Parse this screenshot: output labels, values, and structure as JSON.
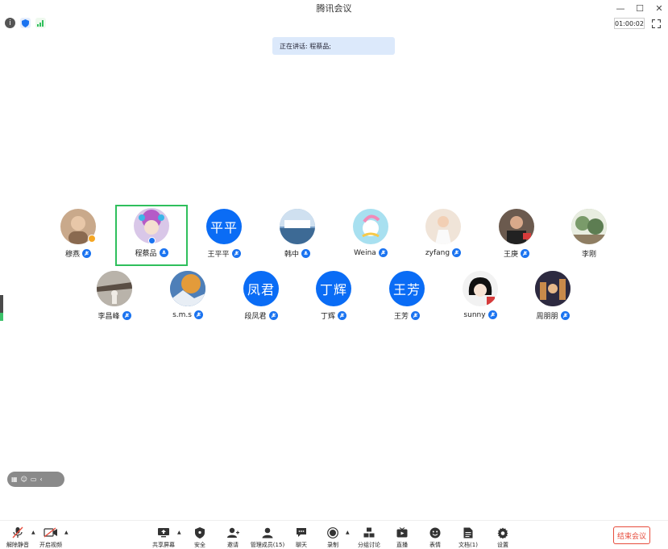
{
  "window": {
    "title": "腾讯会议",
    "controls": [
      "—",
      "☐",
      "✕"
    ]
  },
  "status": {
    "timer": "01:00:02"
  },
  "speaking": {
    "text": "正在讲话: 程蔡品;"
  },
  "participants": [
    {
      "name": "穆燕",
      "avatar_type": "photo",
      "color": "#c9a98b"
    },
    {
      "name": "程蔡品",
      "avatar_type": "photo",
      "color": "#d9c7e8"
    },
    {
      "name": "王平平",
      "avatar_type": "text",
      "avatar_text": "平平"
    },
    {
      "name": "韩中",
      "avatar_type": "photo",
      "color": "#7aa0c8"
    },
    {
      "name": "Weina",
      "avatar_type": "photo",
      "color": "#a8e0f0"
    },
    {
      "name": "zyfang",
      "avatar_type": "photo",
      "color": "#f0e4d8"
    },
    {
      "name": "王庚",
      "avatar_type": "photo",
      "color": "#6b5a4e"
    },
    {
      "name": "李刚",
      "avatar_type": "photo",
      "color": "#9bb08a"
    },
    {
      "name": "李昌峰",
      "avatar_type": "photo",
      "color": "#8a8580"
    },
    {
      "name": "s.m.s",
      "avatar_type": "photo",
      "color": "#4e7fb8"
    },
    {
      "name": "段凤君",
      "avatar_type": "text",
      "avatar_text": "凤君"
    },
    {
      "name": "丁辉",
      "avatar_type": "text",
      "avatar_text": "丁辉"
    },
    {
      "name": "王芳",
      "avatar_type": "text",
      "avatar_text": "王芳"
    },
    {
      "name": "sunny",
      "avatar_type": "photo",
      "color": "#f2f2f2"
    },
    {
      "name": "周朋朋",
      "avatar_type": "photo",
      "color": "#3a3040"
    }
  ],
  "toolbar": {
    "unmute": "解除静音",
    "start_video": "开启视频",
    "share_screen": "共享屏幕",
    "security": "安全",
    "invite": "邀请",
    "manage_members": "管理成员(15)",
    "chat": "聊天",
    "record": "录制",
    "breakout": "分组讨论",
    "live": "直播",
    "reactions": "表情",
    "docs": "文档(1)",
    "settings": "设置",
    "end_meeting": "结束会议"
  },
  "colors": {
    "accent": "#0a6cf5",
    "active_border": "#2fbf5c",
    "end_red": "#e74c3c"
  }
}
